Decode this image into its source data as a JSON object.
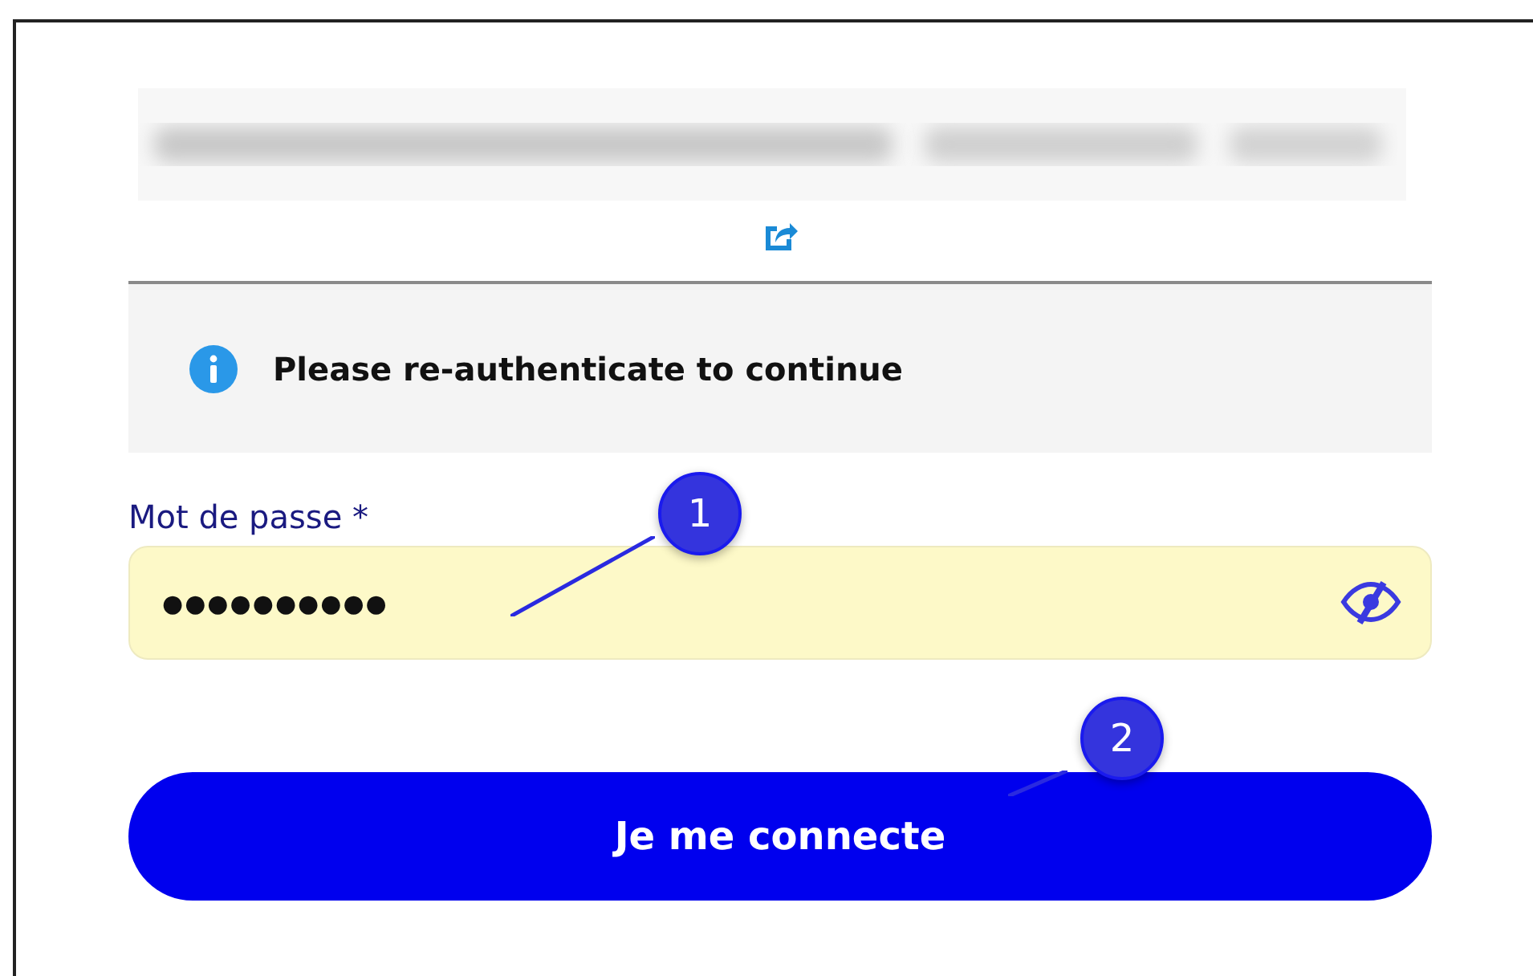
{
  "notice": {
    "text": "Please re-authenticate to continue"
  },
  "password_field": {
    "label": "Mot de passe *",
    "value": "●●●●●●●●●●"
  },
  "submit_button": {
    "label": "Je me connecte"
  },
  "callouts": [
    {
      "number": "1"
    },
    {
      "number": "2"
    }
  ]
}
